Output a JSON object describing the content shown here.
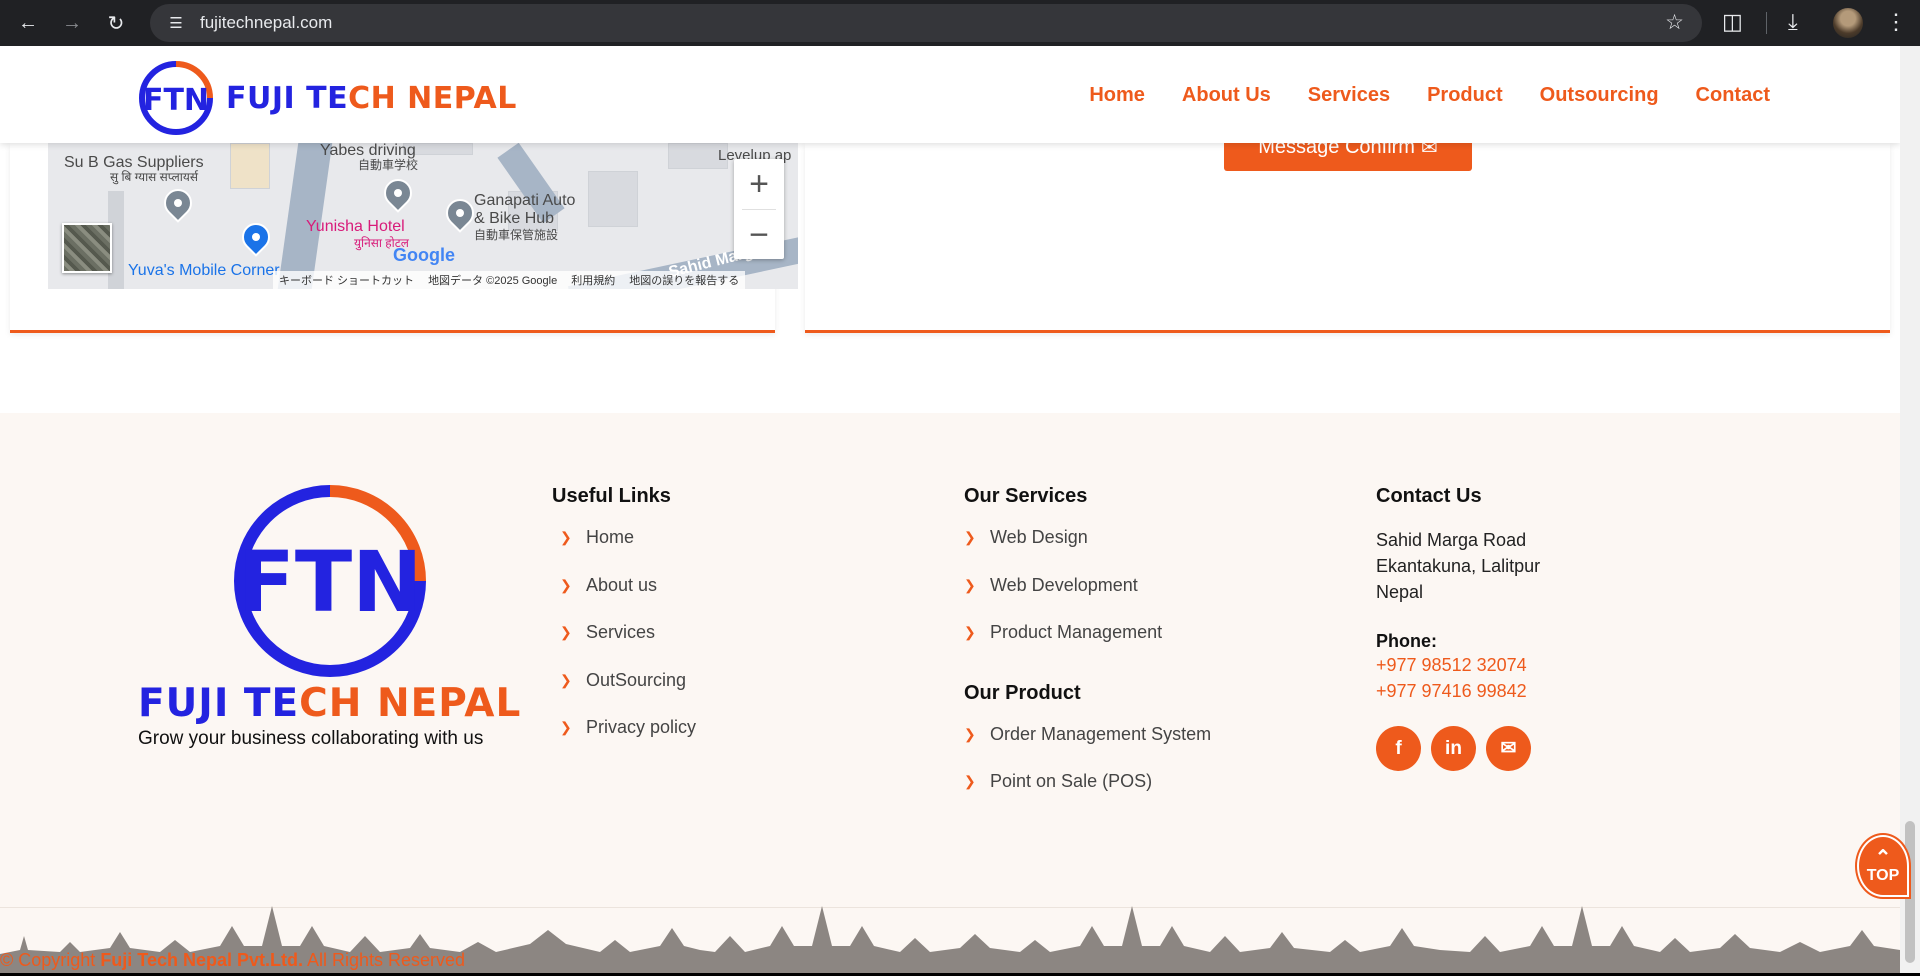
{
  "browser": {
    "url": "fujitechnepal.com",
    "icons": [
      "back-icon",
      "forward-icon",
      "reload-icon",
      "site-info-icon",
      "bookmark-star-icon",
      "extensions-icon",
      "download-icon",
      "profile-avatar",
      "menu-dots-icon"
    ]
  },
  "header": {
    "logo_mark": "FTN",
    "brand_part1": "FUJI TE",
    "brand_part2": "CH NEPAL",
    "nav": [
      "Home",
      "About Us",
      "Services",
      "Product",
      "Outsourcing",
      "Contact"
    ]
  },
  "map": {
    "labels": {
      "su_b_gas": "Su B Gas Suppliers",
      "su_b_gas_local": "सु बि ग्यास सप्लायर्स",
      "yabes": "Yabes driving",
      "yabes_local": "自動車学校",
      "levelup": "Levelup ap",
      "ganapati1": "Ganapati Auto",
      "ganapati2": "& Bike Hub",
      "ganapati_local": "自動車保管施設",
      "yunisha": "Yunisha Hotel",
      "yunisha_local": "युनिसा होटल",
      "yuva": "Yuva's Mobile Corner",
      "sahid": "Sahid Marg"
    },
    "google": "Google",
    "zoom_in": "+",
    "zoom_out": "−",
    "attribution": [
      "キーボード ショートカット",
      "地図データ ©2025 Google",
      "利用規約",
      "地図の誤りを報告する"
    ]
  },
  "form": {
    "confirm_label": "Message Confirm",
    "confirm_icon": "✉"
  },
  "footer": {
    "logo_mark": "FTN",
    "brand_part1": "FUJI TE",
    "brand_part2": "CH NEPAL",
    "tagline": "Grow your business collaborating with us",
    "useful_links": {
      "title": "Useful Links",
      "items": [
        "Home",
        "About us",
        "Services",
        "OutSourcing",
        "Privacy policy"
      ]
    },
    "services": {
      "title": "Our Services",
      "items": [
        "Web Design",
        "Web Development",
        "Product Management"
      ]
    },
    "products": {
      "title": "Our Product",
      "items": [
        "Order Management System",
        "Point on Sale (POS)"
      ]
    },
    "contact": {
      "title": "Contact Us",
      "address": [
        "Sahid Marga Road",
        "Ekantakuna, Lalitpur",
        "Nepal"
      ],
      "phone_label": "Phone:",
      "phones": [
        "+977 98512 32074",
        "+977 97416 99842"
      ],
      "socials": [
        "facebook-icon",
        "linkedin-icon",
        "email-icon"
      ]
    },
    "copyright_prefix": "© Copyright ",
    "copyright_company": "Fuji Tech Nepal Pvt.Ltd.",
    "copyright_suffix": " All Rights Reserved",
    "top_label": "TOP"
  },
  "colors": {
    "accent": "#ee5a1c",
    "brand_blue": "#2323e0",
    "footer_bg": "#fcf7f3"
  }
}
